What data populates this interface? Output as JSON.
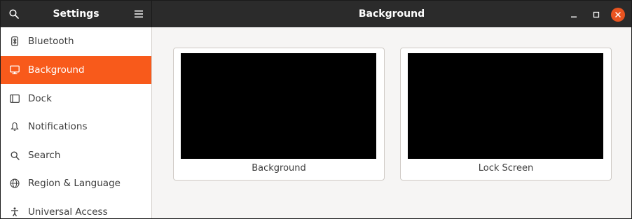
{
  "header": {
    "left_title": "Settings",
    "title": "Background"
  },
  "sidebar": {
    "items": [
      {
        "label": "Bluetooth",
        "icon": "bluetooth-icon",
        "active": false
      },
      {
        "label": "Background",
        "icon": "display-icon",
        "active": true
      },
      {
        "label": "Dock",
        "icon": "dock-icon",
        "active": false
      },
      {
        "label": "Notifications",
        "icon": "bell-icon",
        "active": false
      },
      {
        "label": "Search",
        "icon": "search-icon",
        "active": false
      },
      {
        "label": "Region & Language",
        "icon": "globe-icon",
        "active": false
      },
      {
        "label": "Universal Access",
        "icon": "accessibility-icon",
        "active": false
      }
    ]
  },
  "main": {
    "cards": [
      {
        "label": "Background"
      },
      {
        "label": "Lock Screen"
      }
    ]
  },
  "colors": {
    "accent": "#f85a1b",
    "close_button": "#e95420",
    "headerbar": "#2b2b2b",
    "preview": "#000000"
  }
}
